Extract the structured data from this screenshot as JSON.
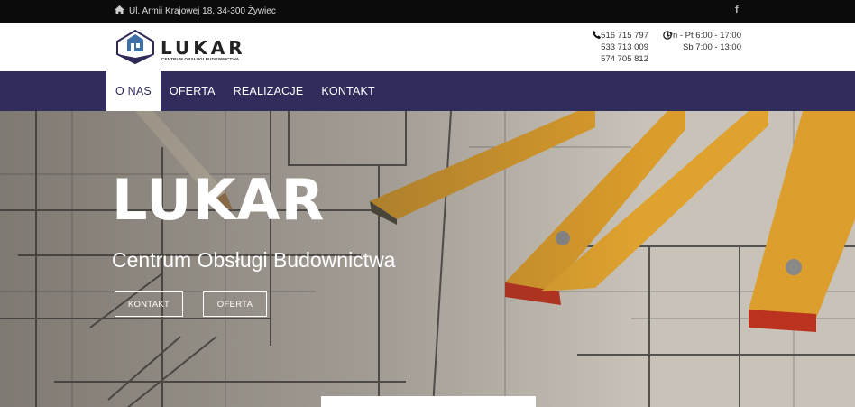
{
  "topbar": {
    "address": "Ul. Armii Krajowej 18, 34-300 Żywiec",
    "home_icon": "home-icon",
    "social_icon": "facebook-icon",
    "social_glyph": "f"
  },
  "header": {
    "logo_text": "LUKAR",
    "logo_subtitle": "CENTRUM OBSŁUGI BUDOWNICTWA",
    "phones": [
      "516 715 797",
      "533 713 009",
      "574 705 812"
    ],
    "phone_icon": "phone-icon",
    "hours": [
      "Pn - Pt 6:00 - 17:00",
      "Sb 7:00 - 13:00"
    ],
    "clock_icon": "clock-icon"
  },
  "nav": {
    "items": [
      {
        "label": "O NAS",
        "active": true
      },
      {
        "label": "OFERTA",
        "active": false
      },
      {
        "label": "REALIZACJE",
        "active": false
      },
      {
        "label": "KONTAKT",
        "active": false
      }
    ]
  },
  "hero": {
    "title": "LUKAR",
    "subtitle": "Centrum Obsługi Budownictwa",
    "buttons": [
      "KONTAKT",
      "OFERTA"
    ]
  },
  "colors": {
    "nav_bg": "#302d5c",
    "topbar_bg": "#0b0b0b",
    "ruler": "#e2a12a"
  }
}
